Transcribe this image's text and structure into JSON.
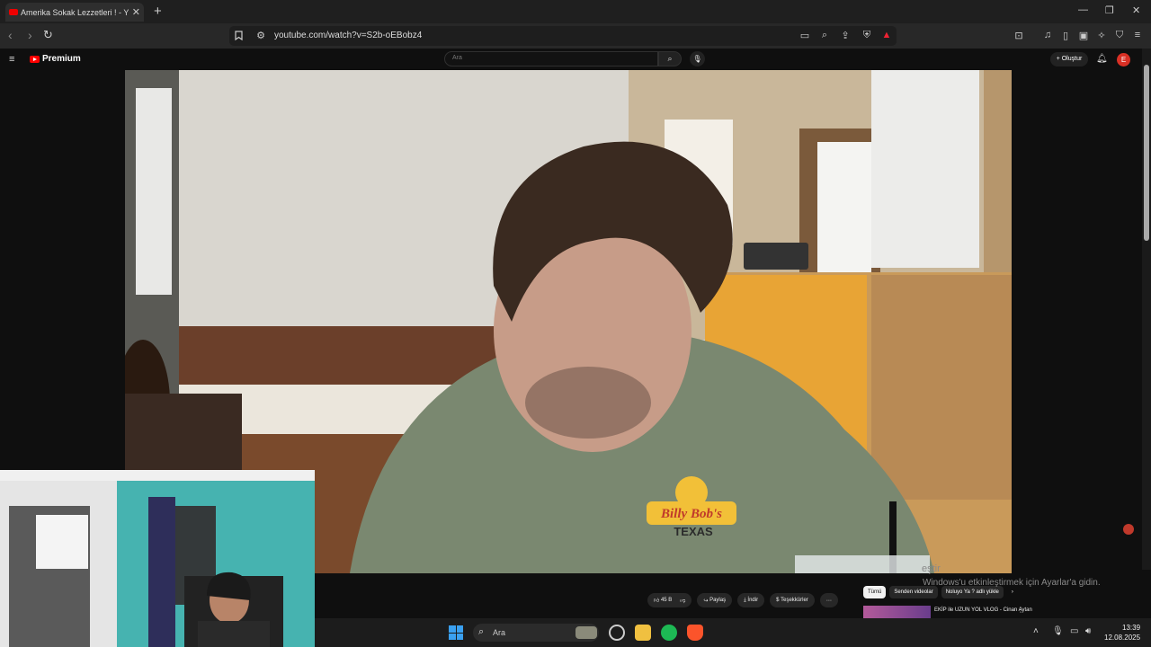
{
  "browser": {
    "tab_title": "Amerika Sokak Lezzetleri ! - Y",
    "url": "youtube.com/watch?v=S2b-oEBobz4"
  },
  "youtube": {
    "logo_text": "Premium",
    "search_placeholder": "Ara",
    "create_label": "Oluştur",
    "avatar_letter": "E"
  },
  "video": {
    "shirt_logo_line1": "Billy Bob's",
    "shirt_logo_line2": "TEXAS"
  },
  "actions": {
    "likes": "45 B",
    "share": "Paylaş",
    "download": "İndir",
    "thanks": "Teşekkürler",
    "more": "⋯"
  },
  "recommendations": {
    "chips": [
      "Tümü",
      "Senden videolar",
      "Noluyo Ya ? adlı yükle"
    ],
    "first_title": "EKİP ile UZUN YOL VLOG - Cinan Aytan"
  },
  "os": {
    "watermark_line1": "eştir",
    "watermark_line2": "Windows'u etkinleştirmek için Ayarlar'a gidin.",
    "taskbar_search": "Ara",
    "time": "13:39",
    "date": "12.08.2025"
  },
  "colors": {
    "youtube_red": "#ff0000",
    "windows_blue": "#3aa0f0",
    "spotify_green": "#1db954"
  }
}
